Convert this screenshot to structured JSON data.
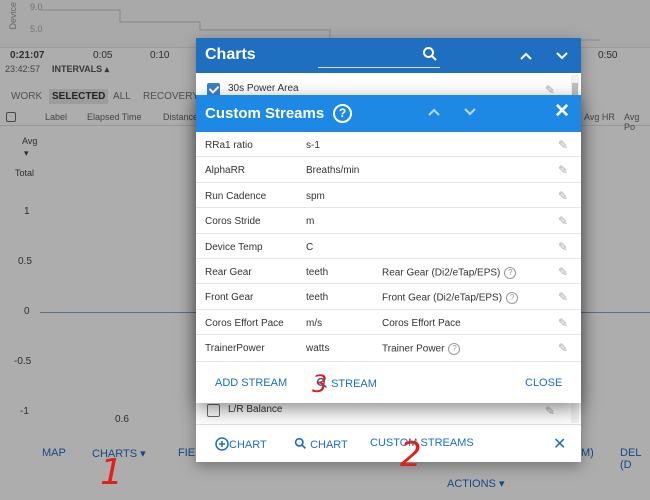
{
  "background": {
    "chart_strip": {
      "axis_label": "Device",
      "yvals": [
        "9.0",
        "5.0"
      ]
    },
    "time_ticks": [
      "0:21:07",
      "0:05",
      "0:10",
      "0:50"
    ],
    "sub_time": "23:42:57",
    "intervals_label": "INTERVALS ▴",
    "filters": [
      "WORK",
      "SELECTED",
      "ALL",
      "RECOVERY"
    ],
    "columns": [
      "Label",
      "Elapsed Time",
      "Distance",
      "Avg HR",
      "Avg Po"
    ],
    "avg_label": "Avg",
    "total_label": "Total",
    "y_ticks": [
      "1",
      "0.5",
      "0",
      "-0.5",
      "-1"
    ],
    "bottom_value": "0.6",
    "bottom_nav": {
      "map": "MAP",
      "charts": "CHARTS ▾",
      "fie": "FIE",
      "m": "M)",
      "del": "DEL (D"
    },
    "actions_label": "ACTIONS ▾"
  },
  "charts_dialog": {
    "title": "Charts",
    "rows": [
      {
        "label": "30s Power Area",
        "checked": true
      },
      {
        "label": "L/R Balance",
        "checked": false
      }
    ],
    "footer": {
      "add_chart": "CHART",
      "search_chart": "CHART",
      "custom_streams": "CUSTOM STREAMS"
    }
  },
  "custom_streams_dialog": {
    "title": "Custom Streams",
    "help": "?",
    "streams": [
      {
        "name": "RRa1 ratio",
        "unit": "s-1",
        "extra": ""
      },
      {
        "name": "AlphaRR",
        "unit": "Breaths/min",
        "extra": ""
      },
      {
        "name": "Run Cadence",
        "unit": "spm",
        "extra": ""
      },
      {
        "name": "Coros Stride",
        "unit": "m",
        "extra": ""
      },
      {
        "name": "Device Temp",
        "unit": "C",
        "extra": ""
      },
      {
        "name": "Rear Gear",
        "unit": "teeth",
        "extra": "Rear Gear (Di2/eTap/EPS)",
        "help": true
      },
      {
        "name": "Front Gear",
        "unit": "teeth",
        "extra": "Front Gear (Di2/eTap/EPS)",
        "help": true
      },
      {
        "name": "Coros Effort Pace",
        "unit": "m/s",
        "extra": "Coros Effort Pace",
        "help": false
      },
      {
        "name": "TrainerPower",
        "unit": "watts",
        "extra": "Trainer Power",
        "help": true
      }
    ],
    "footer": {
      "add_stream": "ADD STREAM",
      "search_stream": "STREAM",
      "close": "CLOSE"
    }
  },
  "annotations": {
    "one": "1",
    "two": "2",
    "three": "3",
    "color": "#e0201b"
  }
}
